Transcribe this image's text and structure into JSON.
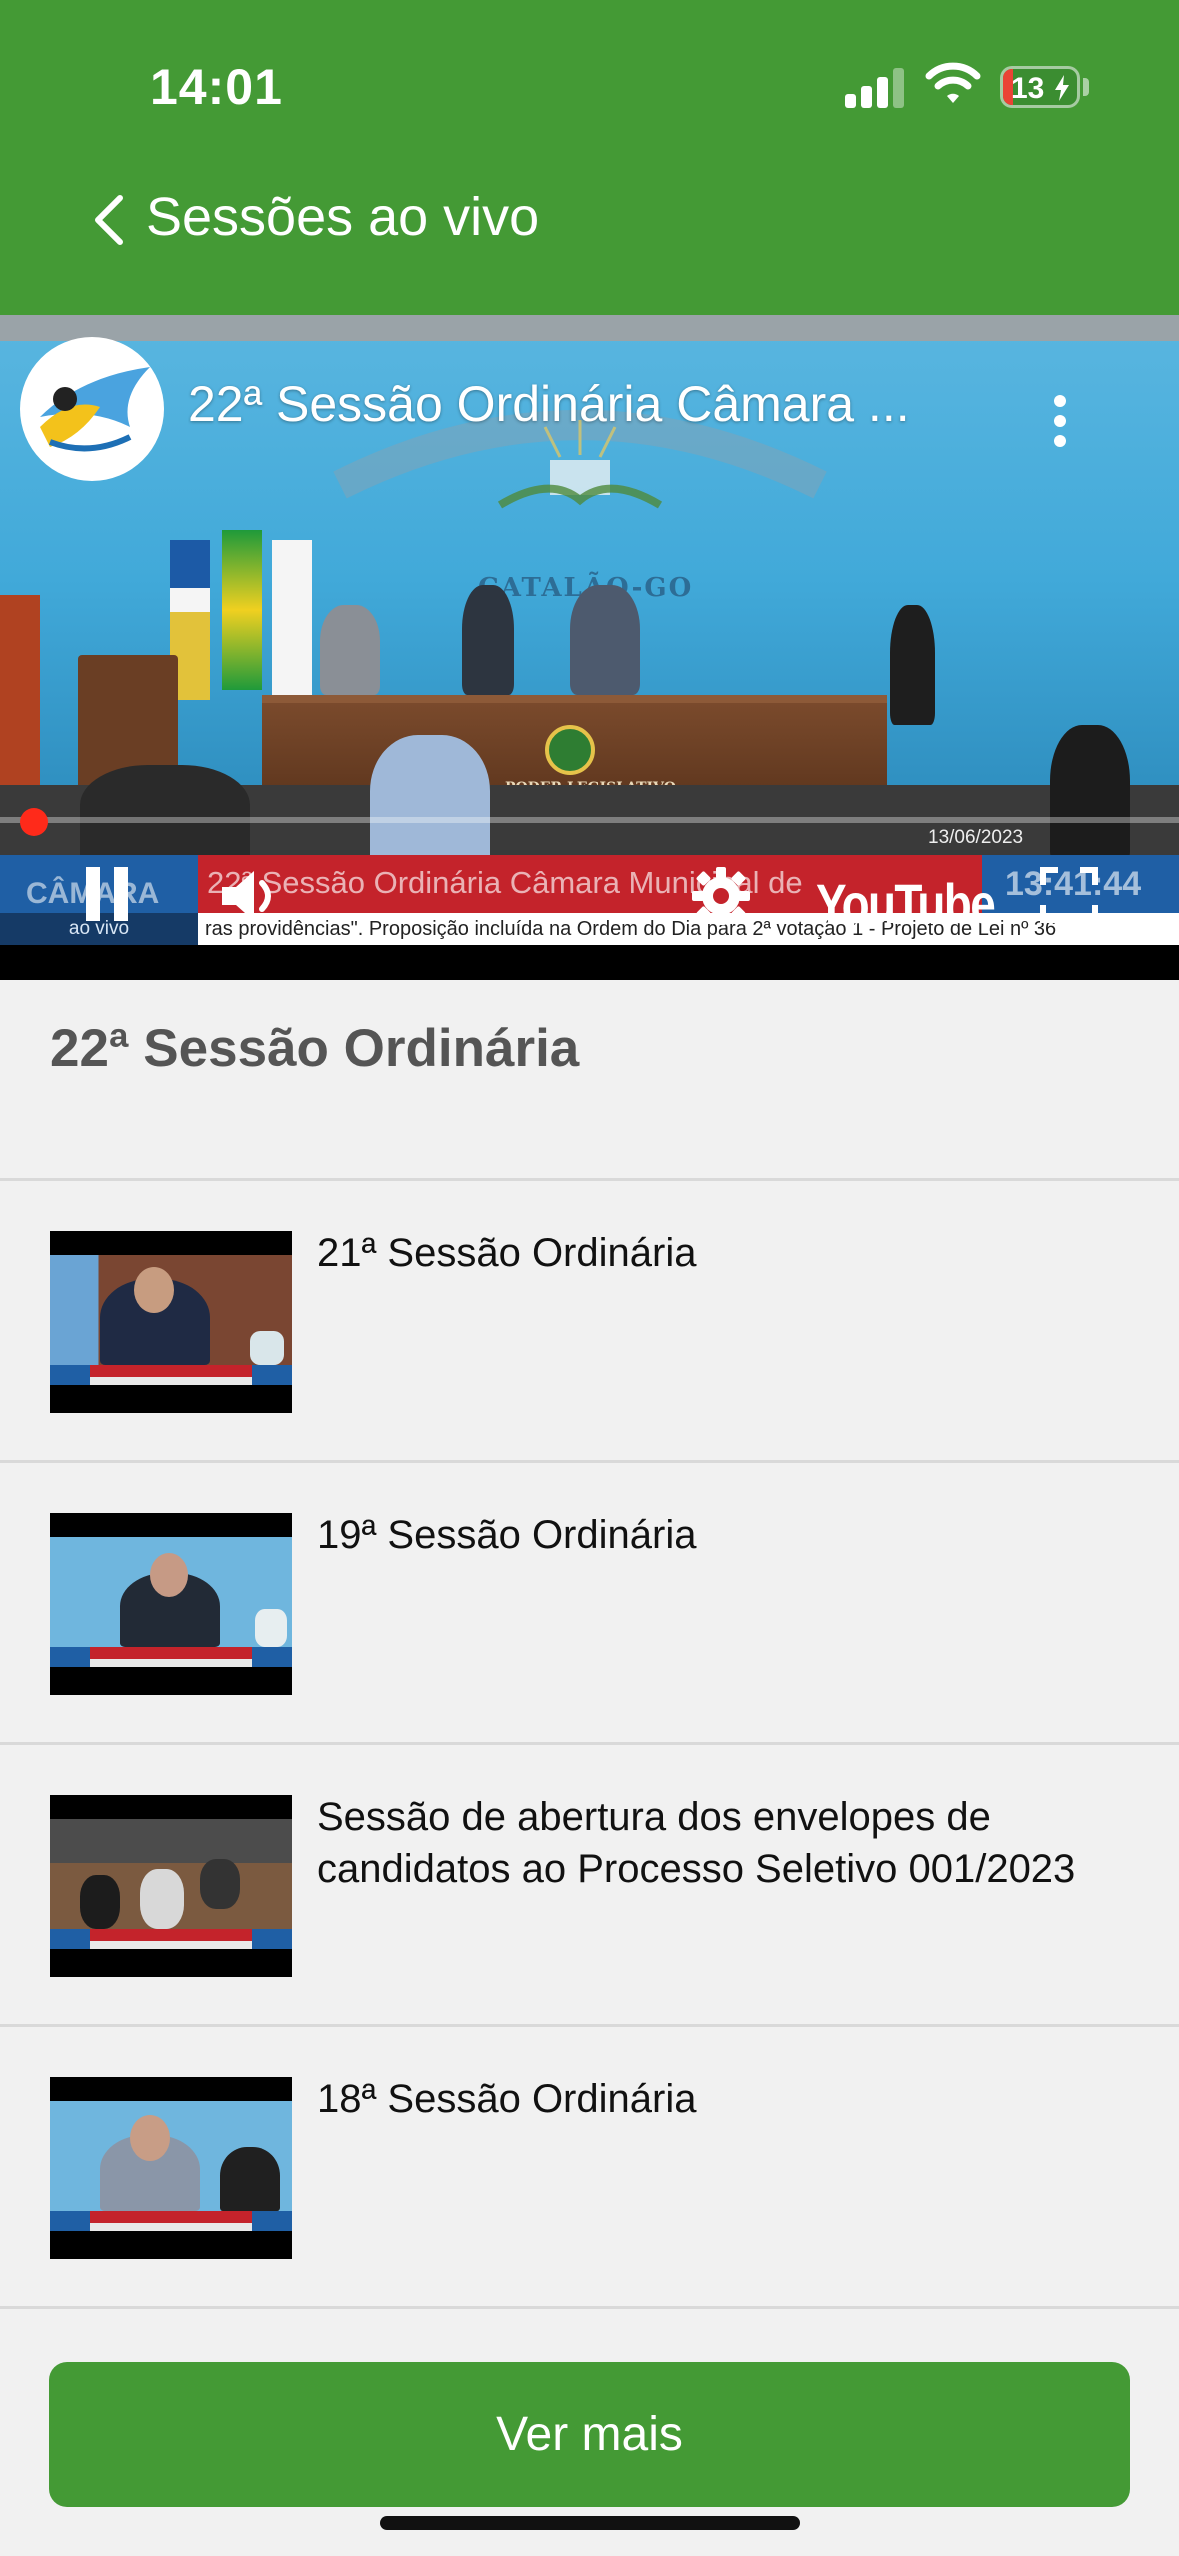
{
  "status_bar": {
    "time": "14:01",
    "battery": "13",
    "battery_level": 0.13,
    "icons": [
      "signal-icon",
      "wifi-icon",
      "battery-charging-icon"
    ]
  },
  "nav": {
    "back_icon": "chevron-left-icon",
    "title": "Sessões ao vivo"
  },
  "player": {
    "title": "22ª Sessão Ordinária Câmara ...",
    "date": "13/06/2023",
    "lower_third_channel": "CÂMARA",
    "lower_third_text": "22ª Sessão Ordinária Câmara Municipal de",
    "clock": "13:41:44",
    "badge": "ao vivo",
    "ticker": "ras providências\".     Proposição incluída na Ordem do Dia para 2ª votação  1 - Projeto de Lei nº 36",
    "youtube": "YouTube",
    "wall_city": "CATALÃO-GO",
    "table_text": "PODER LEGISLATIVO",
    "progress": 0.02
  },
  "current_session": {
    "title": "22ª Sessão Ordinária"
  },
  "sessions": [
    {
      "title": "21ª Sessão Ordinária"
    },
    {
      "title": "19ª Sessão Ordinária"
    },
    {
      "title": "Sessão de abertura dos envelopes de candidatos ao Processo Seletivo 001/2023"
    },
    {
      "title": "18ª Sessão Ordinária"
    }
  ],
  "more_button": {
    "label": "Ver mais"
  },
  "colors": {
    "brand_green": "#449a35",
    "background": "#f1f1f1",
    "title_gray": "#555555",
    "progress_red": "#ff2a1a"
  }
}
